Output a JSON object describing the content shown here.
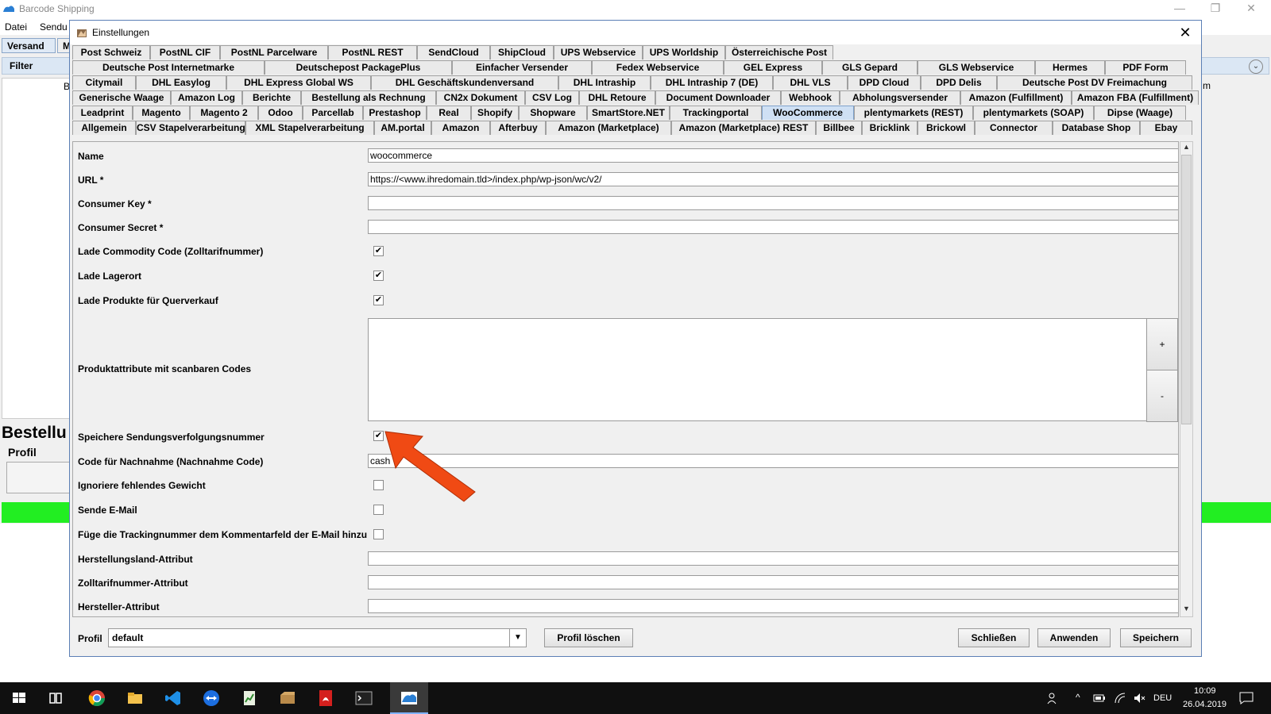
{
  "app": {
    "title": "Barcode Shipping",
    "menu": [
      "Datei",
      "Sendu"
    ],
    "tabs": [
      "Versand",
      "M"
    ],
    "filter_label": "Filter",
    "bestellung_label": "Bestellu",
    "profil_label": "Profil",
    "stray_letter_b": "B",
    "stray_letter_m": "m",
    "window_controls": {
      "minimize": "—",
      "restore": "❐",
      "close": "✕"
    }
  },
  "dialog": {
    "title": "Einstellungen",
    "close_glyph": "✕",
    "tab_rows": [
      [
        "Post Schweiz",
        "PostNL CIF",
        "PostNL Parcelware",
        "PostNL REST",
        "SendCloud",
        "ShipCloud",
        "UPS Webservice",
        "UPS Worldship",
        "Österreichische Post"
      ],
      [
        "Deutsche Post Internetmarke",
        "Deutschepost PackagePlus",
        "Einfacher Versender",
        "Fedex Webservice",
        "GEL Express",
        "GLS Gepard",
        "GLS Webservice",
        "Hermes",
        "PDF Form"
      ],
      [
        "Citymail",
        "DHL Easylog",
        "DHL Express Global WS",
        "DHL Geschäftskundenversand",
        "DHL Intraship",
        "DHL Intraship 7 (DE)",
        "DHL VLS",
        "DPD Cloud",
        "DPD Delis",
        "Deutsche Post DV Freimachung"
      ],
      [
        "Generische Waage",
        "Amazon Log",
        "Berichte",
        "Bestellung als Rechnung",
        "CN2x Dokument",
        "CSV Log",
        "DHL Retoure",
        "Document Downloader",
        "Webhook",
        "Abholungsversender",
        "Amazon (Fulfillment)",
        "Amazon FBA (Fulfillment)"
      ],
      [
        "Leadprint",
        "Magento",
        "Magento 2",
        "Odoo",
        "Parcellab",
        "Prestashop",
        "Real",
        "Shopify",
        "Shopware",
        "SmartStore.NET",
        "Trackingportal",
        "WooCommerce",
        "plentymarkets (REST)",
        "plentymarkets (SOAP)",
        "Dipse (Waage)"
      ],
      [
        "Allgemein",
        "CSV Stapelverarbeitung",
        "XML Stapelverarbeitung",
        "AM.portal",
        "Amazon",
        "Afterbuy",
        "Amazon (Marketplace)",
        "Amazon (Marketplace) REST",
        "Billbee",
        "Bricklink",
        "Brickowl",
        "Connector",
        "Database Shop",
        "Ebay"
      ]
    ],
    "selected_tab": "WooCommerce",
    "form": {
      "name_label": "Name",
      "name_value": "woocommerce",
      "url_label": "URL *",
      "url_value": "https://<www.ihredomain.tld>/index.php/wp-json/wc/v2/",
      "consumer_key_label": "Consumer Key *",
      "consumer_key_value": "",
      "consumer_secret_label": "Consumer Secret *",
      "consumer_secret_value": "",
      "commodity_label": "Lade Commodity Code (Zolltarifnummer)",
      "lagerort_label": "Lade Lagerort",
      "querverkauf_label": "Lade Produkte für Querverkauf",
      "attr_label": "Produktattribute mit scanbaren Codes",
      "add_btn": "+",
      "remove_btn": "-",
      "tracking_label": "Speichere Sendungsverfolgungsnummer",
      "nachnahme_label": "Code für Nachnahme (Nachnahme Code)",
      "nachnahme_value": "cash",
      "gewicht_label": "Ignoriere fehlendes Gewicht",
      "email_label": "Sende E-Mail",
      "trackcomment_label": "Füge die Trackingnummer dem Kommentarfeld der E-Mail hinzu",
      "herkunft_label": "Herstellungsland-Attribut",
      "herkunft_value": "",
      "zoll_label": "Zolltarifnummer-Attribut",
      "zoll_value": "",
      "hersteller_label": "Hersteller-Attribut",
      "hersteller_value": "",
      "check_mark": "✔",
      "checkboxes": {
        "commodity": true,
        "lagerort": true,
        "querverkauf": true,
        "tracking": true,
        "gewicht": false,
        "email": false,
        "trackcomment": false
      }
    },
    "footer": {
      "profile_label": "Profil",
      "profile_value": "default",
      "delete_btn": "Profil löschen",
      "close_btn": "Schließen",
      "apply_btn": "Anwenden",
      "save_btn": "Speichern"
    },
    "scroll_up": "▲",
    "scroll_down": "▼",
    "dropdown_glyph": "▼"
  },
  "taskbar": {
    "lang": "DEU",
    "time": "10:09",
    "date": "26.04.2019",
    "icons": [
      "windows-start-icon",
      "task-view-icon",
      "chrome-icon",
      "file-explorer-icon",
      "vscode-icon",
      "teamviewer-icon",
      "spreadsheet-icon",
      "package-icon",
      "pdf-icon",
      "terminal-icon",
      "barcode-shipping-icon"
    ]
  },
  "colors": {
    "accent_selected_tab": "#cfe0f4",
    "status_green": "#22ee22",
    "annotation_arrow": "#f04a14",
    "taskbar_bg": "#101010"
  }
}
